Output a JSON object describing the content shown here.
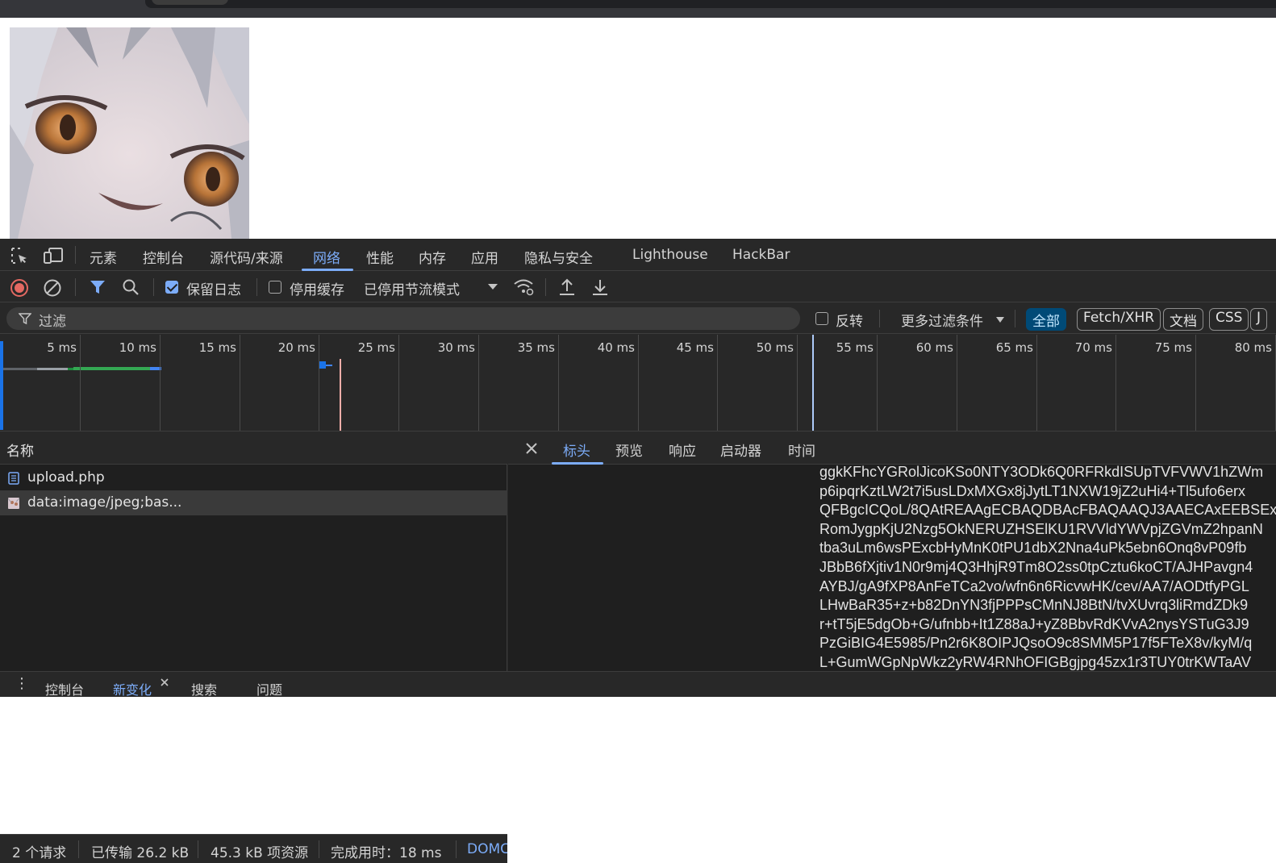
{
  "devtools": {
    "tabs": [
      {
        "label": "元素"
      },
      {
        "label": "控制台"
      },
      {
        "label": "源代码/来源"
      },
      {
        "label": "网络"
      },
      {
        "label": "性能"
      },
      {
        "label": "内存"
      },
      {
        "label": "应用"
      },
      {
        "label": "隐私与安全"
      },
      {
        "label": "Lighthouse"
      },
      {
        "label": "HackBar"
      }
    ],
    "active_tab": "网络",
    "toolbar": {
      "preserve_log_label": "保留日志",
      "preserve_log_checked": true,
      "disable_cache_label": "停用缓存",
      "disable_cache_checked": false,
      "throttle_value": "已停用节流模式"
    },
    "filter": {
      "placeholder": "过滤",
      "invert_label": "反转",
      "more_filters_label": "更多过滤条件",
      "chips": [
        "全部",
        "Fetch/XHR",
        "文档",
        "CSS",
        "J"
      ],
      "active_chip": "全部"
    },
    "timeline": {
      "ticks": [
        "5 ms",
        "10 ms",
        "15 ms",
        "20 ms",
        "25 ms",
        "30 ms",
        "35 ms",
        "40 ms",
        "45 ms",
        "50 ms",
        "55 ms",
        "60 ms",
        "65 ms",
        "70 ms",
        "75 ms",
        "80 ms"
      ]
    },
    "requests": {
      "column_name": "名称",
      "rows": [
        {
          "name": "upload.php",
          "type": "document"
        },
        {
          "name": "data:image/jpeg;bas...",
          "type": "image",
          "selected": true
        }
      ]
    },
    "status": {
      "requests": "2 个请求",
      "transferred": "已传输 26.2 kB",
      "resources": "45.3 kB 项资源",
      "finish": "完成用时：18 ms",
      "dom": "DOMC"
    },
    "detail": {
      "tabs": [
        "标头",
        "预览",
        "响应",
        "启动器",
        "时间"
      ],
      "active_tab": "标头",
      "base64_lines": [
        "ggkKFhcYGRolJicoKSo0NTY3ODk6Q0RFRkdISUpTVFVWV1hZWm",
        "p6ipqrKztLW2t7i5usLDxMXGx8jJytLT1NXW19jZ2uHi4+Tl5ufo6erx",
        "QFBgcICQoL/8QAtREAAgECBAQDBAcFBAQAAQJ3AAECAxEEBSEx",
        "RomJygpKjU2Nzg5OkNERUZHSElKU1RVVldYWVpjZGVmZ2hpanN",
        "tba3uLm6wsPExcbHyMnK0tPU1dbX2Nna4uPk5ebn6Onq8vP09fb",
        "JBbB6fXjtiv1N0r9mj4Q3HhjR9Tm8O2ss0tpCztu6koCT/AJHPavgn4",
        "AYBJ/gA9fXP8AnFeTCa2vo/wfn6n6RicvwHK/cev/AA7/AODtfyPGL",
        "LHwBaR35+z+b82DnYN3fjPPPsCMnNJ8BtN/tvXUvrq3liRmdZDk9",
        "r+tT5jE5dgOb+G/ufnbb+It1Z88aJ+yZ8BbvRdKVvA2nysYSTuG3J9",
        "PzGiBIG4E5985/Pn2r6K8OIPJQsoO9c8SMM5P17f5FTeX8v/kyM/q",
        "L+GumWGpNpWkz2yRW4RNhOFIGBgjpg45zx1r3TUY0trKWTaAV"
      ]
    },
    "drawer": {
      "tabs": [
        "控制台",
        "新变化",
        "搜索",
        "问题"
      ],
      "active_tab": "新变化"
    }
  },
  "colors": {
    "accent": "#7cacf8",
    "panel_bg": "#282828",
    "list_bg": "#1f1f1f",
    "record_red": "#e46962"
  }
}
